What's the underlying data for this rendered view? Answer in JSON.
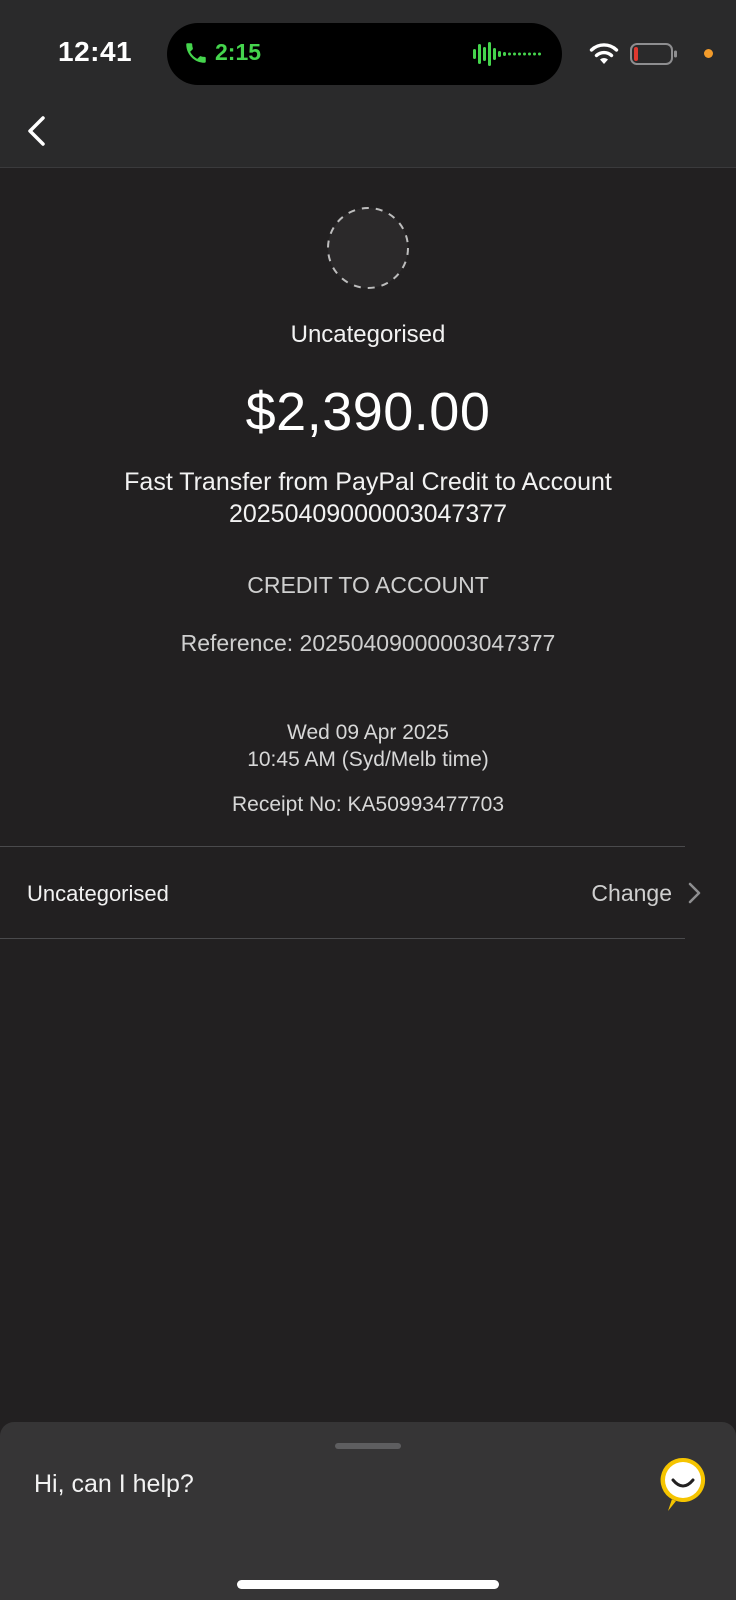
{
  "status_bar": {
    "time": "12:41",
    "call_duration": "2:15",
    "call_color": "#45d54d",
    "battery_color": "#e0382f",
    "indicator_color": "#f29b2b"
  },
  "transaction": {
    "category": "Uncategorised",
    "amount": "$2,390.00",
    "description_line1": "Fast Transfer from PayPal Credit to Account",
    "description_line2": "20250409000003047377",
    "type": "CREDIT TO ACCOUNT",
    "reference": "Reference: 20250409000003047377",
    "date": "Wed 09 Apr 2025",
    "time": "10:45 AM (Syd/Melb time)",
    "receipt": "Receipt No: KA50993477703"
  },
  "category_row": {
    "label": "Uncategorised",
    "action": "Change"
  },
  "help": {
    "prompt": "Hi, can I help?",
    "accent_color": "#f5c400"
  },
  "icons": [
    "phone-icon",
    "audio-waveform-icon",
    "wifi-icon",
    "battery-icon",
    "back-chevron-icon",
    "category-placeholder-icon",
    "chevron-right-icon",
    "assistant-icon"
  ]
}
